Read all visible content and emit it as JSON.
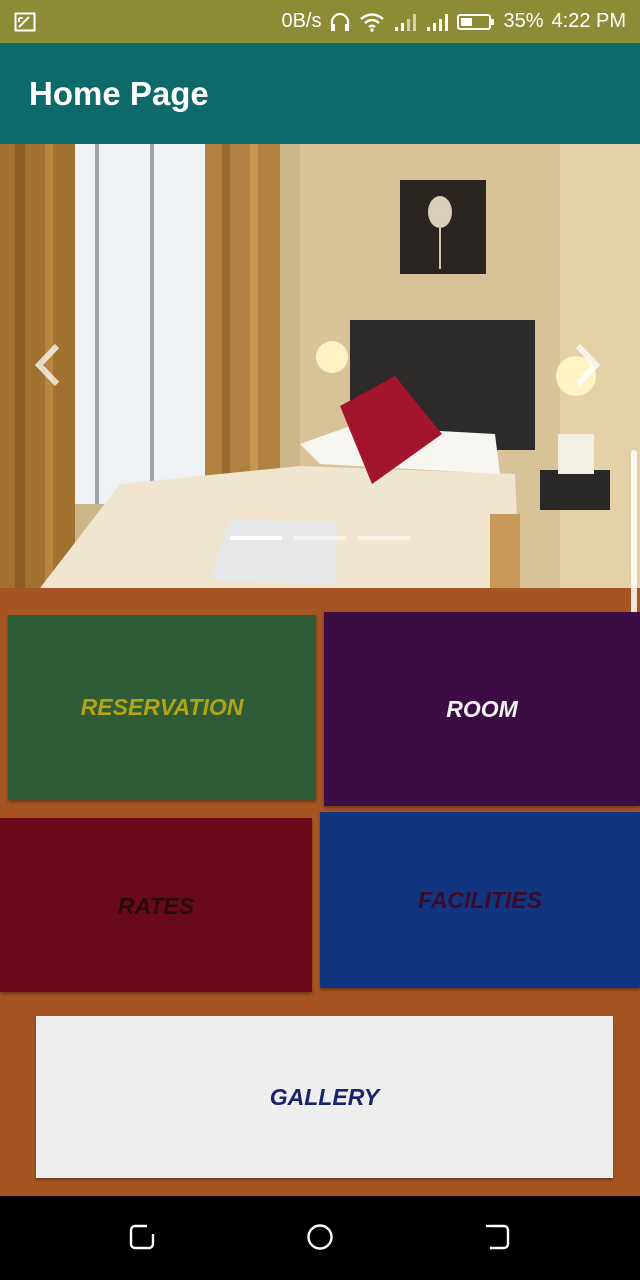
{
  "status_bar": {
    "speed": "0B/s",
    "battery": "35%",
    "time": "4:22 PM",
    "icons": [
      "screenshot-icon",
      "headphones-icon",
      "wifi-icon",
      "signal-icon",
      "signal-icon",
      "battery-icon"
    ]
  },
  "app_bar": {
    "title": "Home Page"
  },
  "carousel": {
    "image": "hotel-room-photo",
    "slide_count": 3,
    "active_slide": 1
  },
  "tiles": {
    "reservation": "RESERVATION",
    "room": "ROOM",
    "rates": "RATES",
    "facilities": "FACILITIES",
    "gallery": "GALLERY"
  },
  "nav_bar": {
    "icons": [
      "recent-apps-icon",
      "home-icon",
      "back-icon"
    ]
  }
}
